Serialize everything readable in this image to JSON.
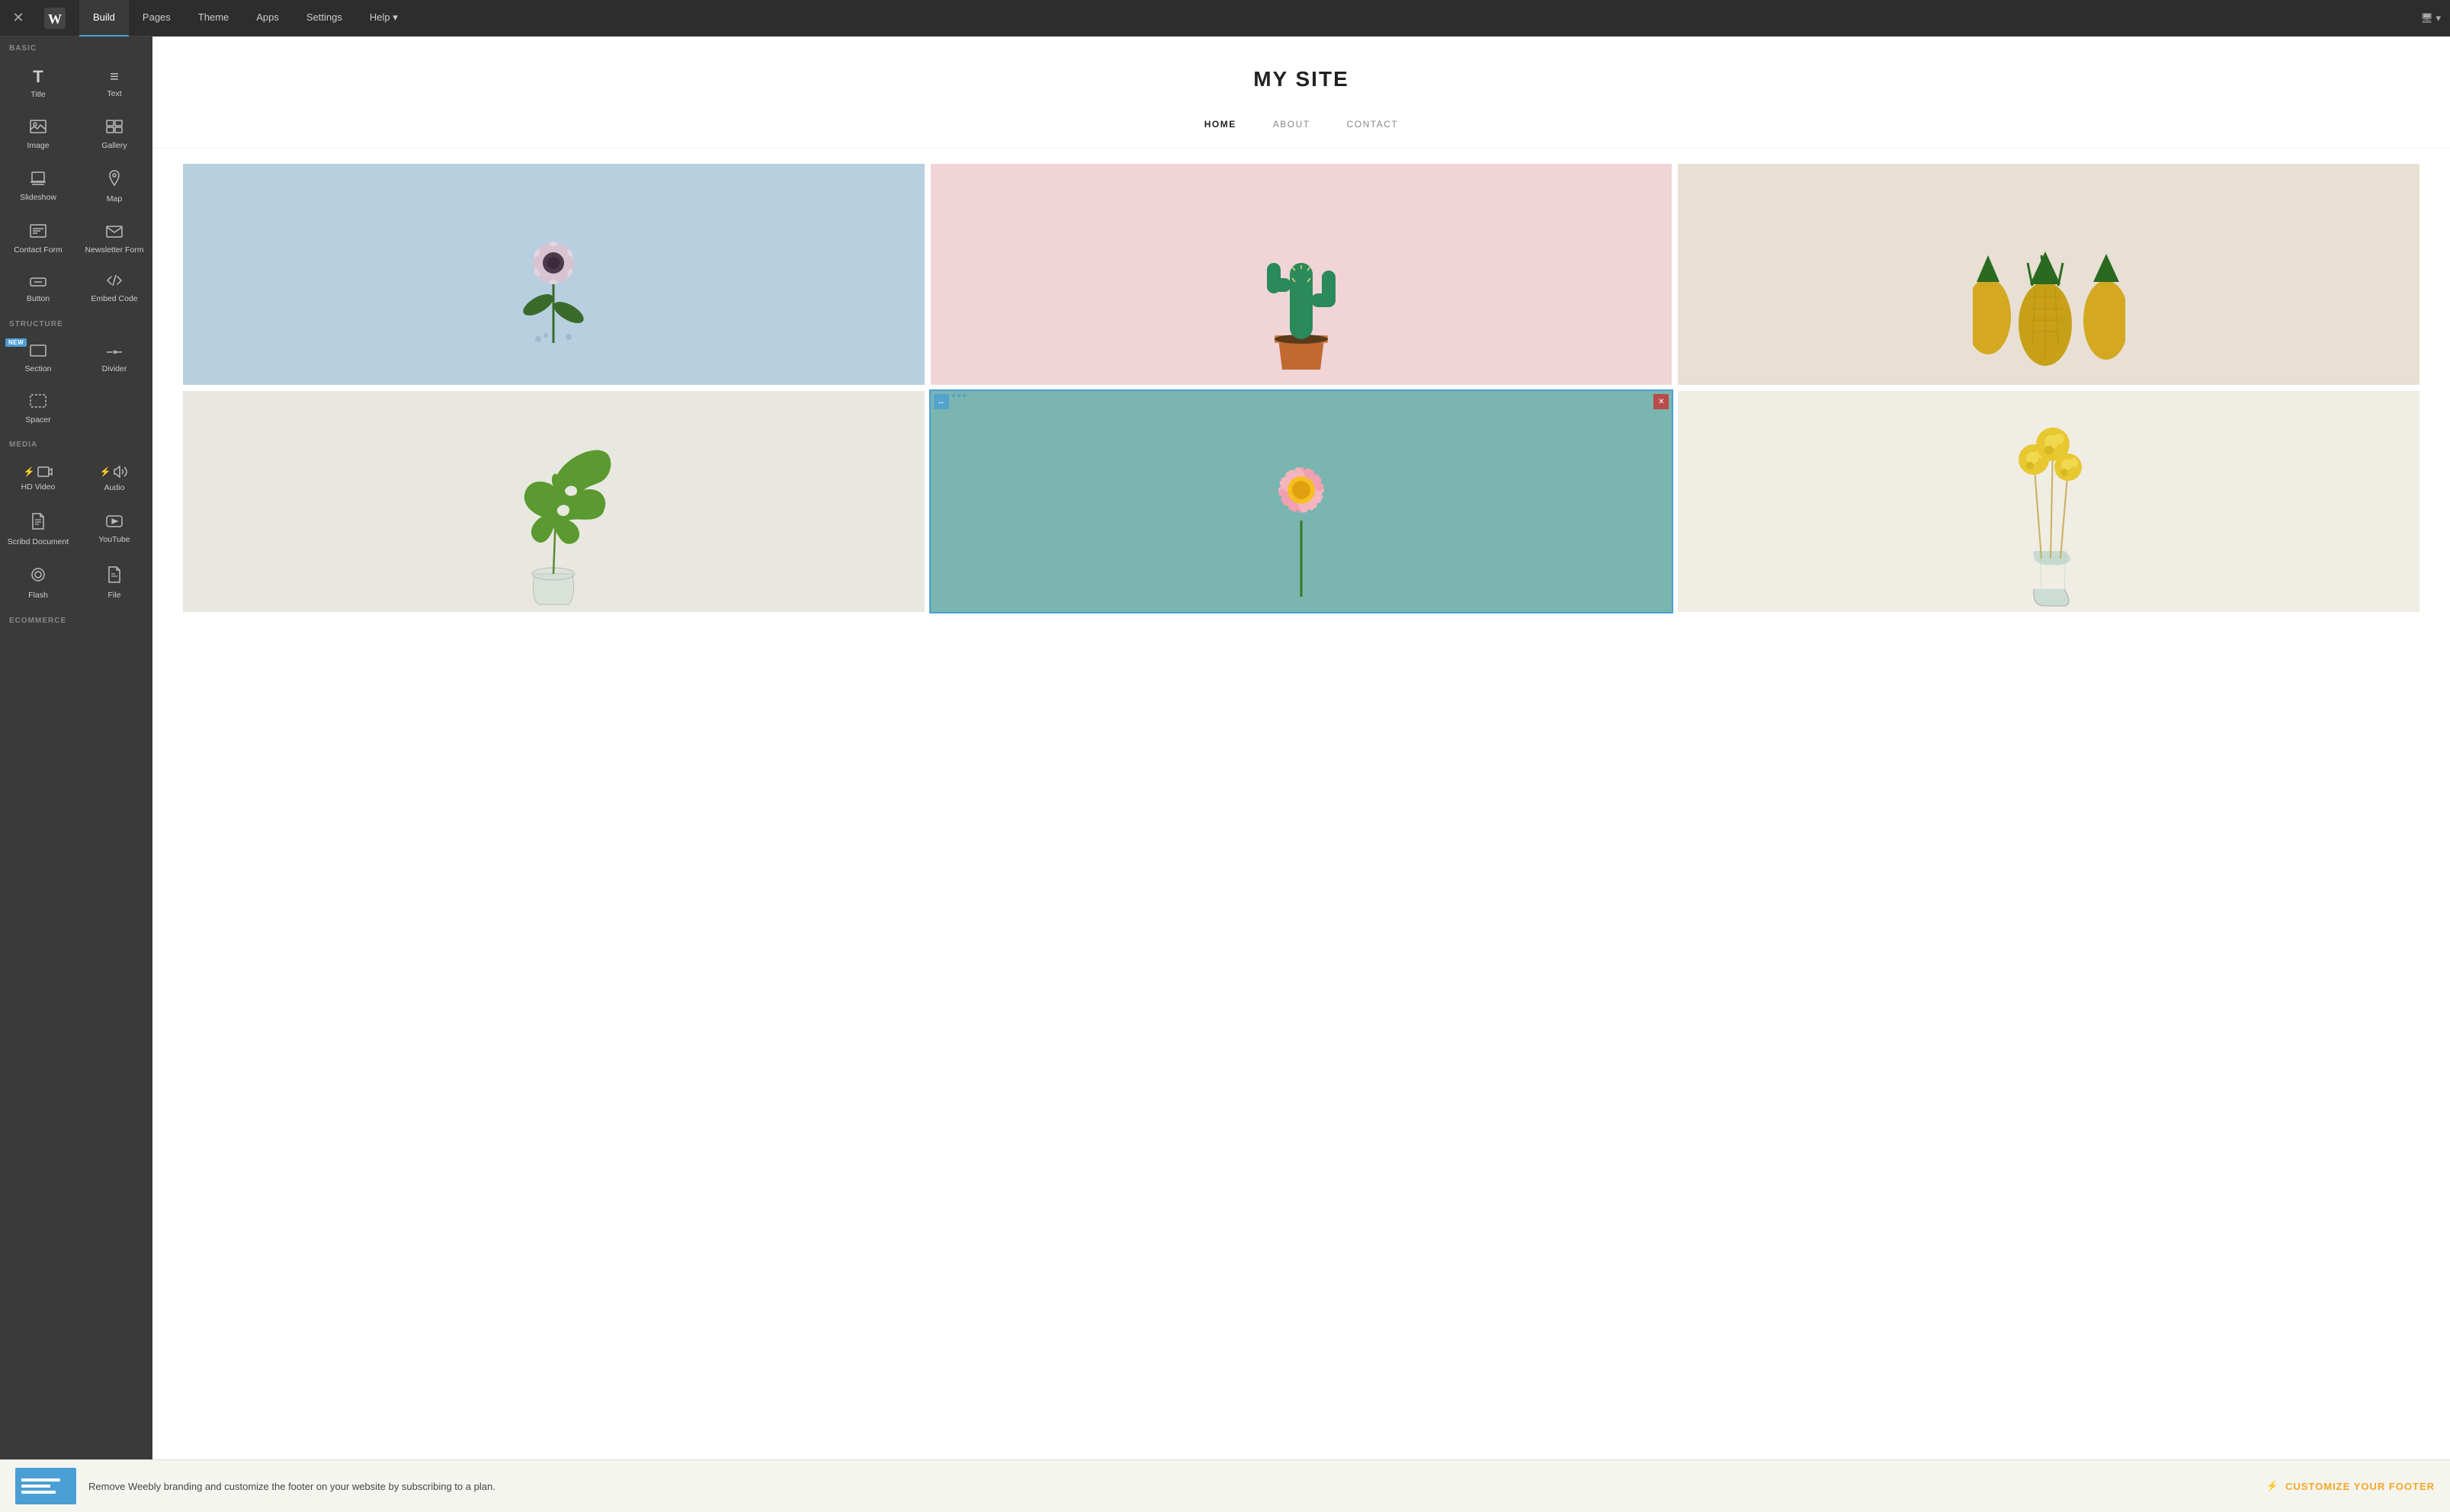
{
  "topNav": {
    "tabs": [
      {
        "id": "build",
        "label": "Build",
        "active": true
      },
      {
        "id": "pages",
        "label": "Pages",
        "active": false
      },
      {
        "id": "theme",
        "label": "Theme",
        "active": false
      },
      {
        "id": "apps",
        "label": "Apps",
        "active": false
      },
      {
        "id": "settings",
        "label": "Settings",
        "active": false
      },
      {
        "id": "help",
        "label": "Help ▾",
        "active": false
      }
    ],
    "device": "🖥 ▾"
  },
  "sidebar": {
    "sections": [
      {
        "label": "BASIC",
        "items": [
          {
            "id": "title",
            "label": "Title",
            "icon": "icon-title",
            "new": false,
            "lightning": false
          },
          {
            "id": "text",
            "label": "Text",
            "icon": "icon-text",
            "new": false,
            "lightning": false
          },
          {
            "id": "image",
            "label": "Image",
            "icon": "icon-image",
            "new": false,
            "lightning": false
          },
          {
            "id": "gallery",
            "label": "Gallery",
            "icon": "icon-gallery",
            "new": false,
            "lightning": false
          },
          {
            "id": "slideshow",
            "label": "Slideshow",
            "icon": "icon-slideshow",
            "new": false,
            "lightning": false
          },
          {
            "id": "map",
            "label": "Map",
            "icon": "icon-map",
            "new": false,
            "lightning": false
          },
          {
            "id": "contact-form",
            "label": "Contact Form",
            "icon": "icon-contact",
            "new": false,
            "lightning": false
          },
          {
            "id": "newsletter",
            "label": "Newsletter Form",
            "icon": "icon-newsletter",
            "new": false,
            "lightning": false
          },
          {
            "id": "button",
            "label": "Button",
            "icon": "icon-button",
            "new": false,
            "lightning": false
          },
          {
            "id": "embed",
            "label": "Embed Code",
            "icon": "icon-embed",
            "new": false,
            "lightning": false
          }
        ]
      },
      {
        "label": "STRUCTURE",
        "items": [
          {
            "id": "section",
            "label": "Section",
            "icon": "icon-section",
            "new": true,
            "lightning": false
          },
          {
            "id": "divider",
            "label": "Divider",
            "icon": "icon-divider",
            "new": false,
            "lightning": false
          },
          {
            "id": "spacer",
            "label": "Spacer",
            "icon": "icon-spacer",
            "new": false,
            "lightning": false
          }
        ]
      },
      {
        "label": "MEDIA",
        "items": [
          {
            "id": "hdvideo",
            "label": "HD Video",
            "icon": "icon-hdvideo",
            "new": false,
            "lightning": true
          },
          {
            "id": "audio",
            "label": "Audio",
            "icon": "icon-audio",
            "new": false,
            "lightning": true
          },
          {
            "id": "scribd",
            "label": "Scribd Document",
            "icon": "icon-scribd",
            "new": false,
            "lightning": false
          },
          {
            "id": "youtube",
            "label": "YouTube",
            "icon": "icon-youtube",
            "new": false,
            "lightning": false
          },
          {
            "id": "flash",
            "label": "Flash",
            "icon": "icon-flash",
            "new": false,
            "lightning": false
          },
          {
            "id": "file",
            "label": "File",
            "icon": "icon-file",
            "new": false,
            "lightning": false
          }
        ]
      },
      {
        "label": "ECOMMERCE",
        "items": []
      }
    ]
  },
  "site": {
    "title": "MY SITE",
    "nav": [
      {
        "label": "HOME",
        "active": true
      },
      {
        "label": "ABOUT",
        "active": false
      },
      {
        "label": "CONTACT",
        "active": false
      }
    ]
  },
  "gallery": {
    "cells": [
      {
        "id": "cell-1",
        "bg": "#b8cfe0",
        "selected": false
      },
      {
        "id": "cell-2",
        "bg": "#f0d4d4",
        "selected": false
      },
      {
        "id": "cell-3",
        "bg": "#e8e0d8",
        "selected": false
      },
      {
        "id": "cell-4",
        "bg": "#e8e8e4",
        "selected": false
      },
      {
        "id": "cell-5",
        "bg": "#7ab5b0",
        "selected": true
      },
      {
        "id": "cell-6",
        "bg": "#f0ede8",
        "selected": false
      }
    ]
  },
  "footer": {
    "text": "Remove Weebly branding and customize the footer on your website by subscribing to a plan.",
    "cta": "CUSTOMIZE YOUR FOOTER",
    "lightning": "⚡"
  }
}
